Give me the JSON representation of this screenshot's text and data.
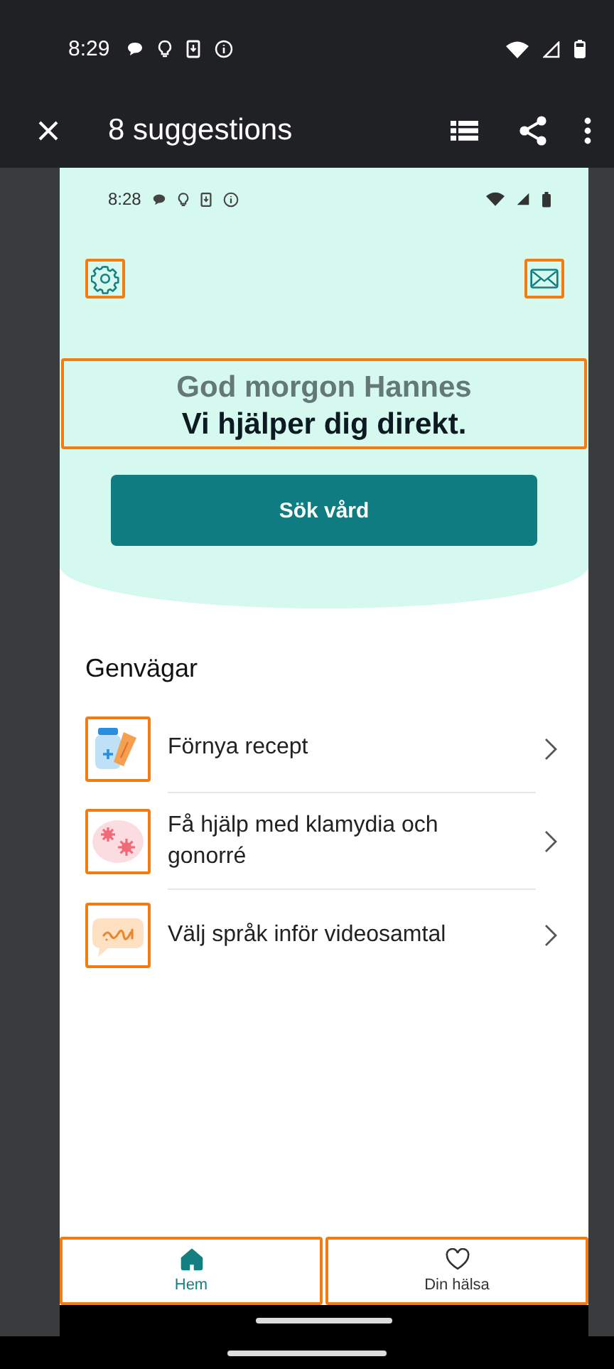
{
  "status_bar": {
    "time": "8:29"
  },
  "app_bar": {
    "title": "8 suggestions"
  },
  "preview": {
    "status_bar": {
      "time": "8:28"
    },
    "settings_highlighted": true,
    "mail_highlighted": true,
    "greeting_highlighted": true,
    "greeting": "God morgon Hannes",
    "headline": "Vi hjälper dig direkt.",
    "search_button": "Sök vård",
    "section_title": "Genvägar",
    "shortcuts": [
      {
        "label": "Förnya recept",
        "kind": "prescription",
        "highlighted": true
      },
      {
        "label": "Få hjälp med klamydia och gonorré",
        "kind": "bacteria",
        "highlighted": true
      },
      {
        "label": "Välj språk inför videosamtal",
        "kind": "speech",
        "highlighted": true
      }
    ],
    "nav": [
      {
        "label": "Hem",
        "kind": "home",
        "selected": true,
        "highlighted": true
      },
      {
        "label": "Din hälsa",
        "kind": "heart",
        "selected": false,
        "highlighted": true
      }
    ]
  }
}
